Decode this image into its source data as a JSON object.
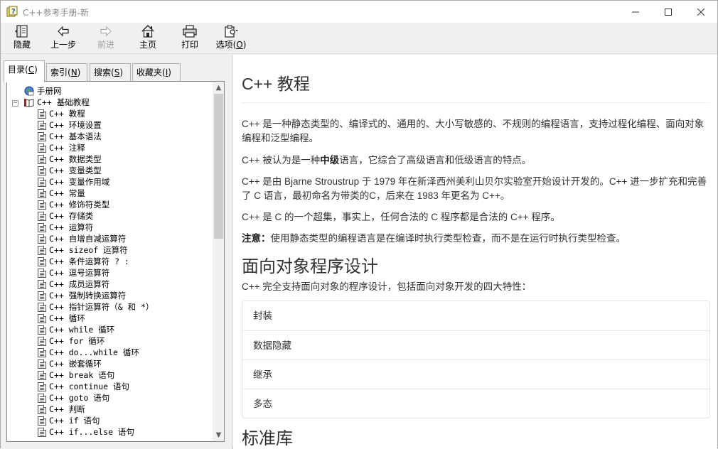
{
  "window": {
    "title": "C++参考手册-新"
  },
  "toolbar": {
    "hide": "隐藏",
    "back": "上一步",
    "forward": "前进",
    "home": "主页",
    "print": "打印",
    "options_prefix": "选项(",
    "options_key": "O",
    "options_suffix": ")"
  },
  "tabs": [
    {
      "label": "目录(",
      "key": "C",
      "suffix": ")"
    },
    {
      "label": "索引(",
      "key": "N",
      "suffix": ")"
    },
    {
      "label": "搜索(",
      "key": "S",
      "suffix": ")"
    },
    {
      "label": "收藏夹(",
      "key": "I",
      "suffix": ")"
    }
  ],
  "tree": {
    "root": "手册网",
    "folder": "C++ 基础教程",
    "items": [
      "C++ 教程",
      "C++ 环境设置",
      "C++ 基本语法",
      "C++ 注释",
      "C++ 数据类型",
      "C++ 变量类型",
      "C++ 变量作用域",
      "C++ 常量",
      "C++ 修饰符类型",
      "C++ 存储类",
      "C++ 运算符",
      "C++ 自增自减运算符",
      "C++ sizeof 运算符",
      "C++ 条件运算符 ? :",
      "C++ 逗号运算符",
      "C++ 成员运算符",
      "C++ 强制转换运算符",
      "C++ 指针运算符（& 和 *）",
      "C++ 循环",
      "C++ while 循环",
      "C++ for 循环",
      "C++ do...while 循环",
      "C++ 嵌套循环",
      "C++ break 语句",
      "C++ continue 语句",
      "C++ goto 语句",
      "C++ 判断",
      "C++ if 语句",
      "C++ if...else 语句"
    ]
  },
  "content": {
    "title": "C++ 教程",
    "p1": "C++ 是一种静态类型的、编译式的、通用的、大小写敏感的、不规则的编程语言，支持过程化编程、面向对象编程和泛型编程。",
    "p2_pre": "C++ 被认为是一种",
    "p2_bold": "中级",
    "p2_post": "语言，它综合了高级语言和低级语言的特点。",
    "p3": "C++ 是由 Bjarne Stroustrup 于 1979 年在新泽西州美利山贝尔实验室开始设计开发的。C++ 进一步扩充和完善了 C 语言，最初命名为带类的C，后来在 1983 年更名为 C++。",
    "p4": "C++ 是 C 的一个超集，事实上，任何合法的 C 程序都是合法的 C++ 程序。",
    "p5_bold": "注意：",
    "p5_text": "使用静态类型的编程语言是在编译时执行类型检查，而不是在运行时执行类型检查。",
    "h_oop": "面向对象程序设计",
    "p6": "C++ 完全支持面向对象的程序设计，包括面向对象开发的四大特性：",
    "features": [
      "封装",
      "数据隐藏",
      "继承",
      "多态"
    ],
    "h_std": "标准库"
  }
}
